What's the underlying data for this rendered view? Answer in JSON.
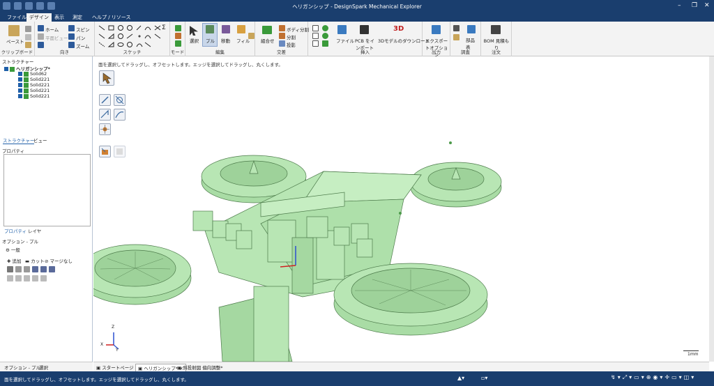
{
  "app": {
    "title": "ヘリガンシップ - DesignSpark Mechanical Explorer"
  },
  "menu_tabs": [
    "ファイル",
    "デザイン",
    "表示",
    "測定",
    "ヘルプ / リソース"
  ],
  "ribbon": {
    "clipboard": {
      "paste": "ペースト",
      "label": "クリップボード"
    },
    "orient": {
      "home": "ホーム",
      "plane": "平面ビュー",
      "spin": "スピン",
      "pan": "パン",
      "zoom": "ズーム",
      "label": "向き"
    },
    "sketch": {
      "label": "スケッチ"
    },
    "mode": {
      "label": "モード"
    },
    "edit": {
      "select": "選択",
      "pull": "プル",
      "move": "移動",
      "fill": "フィル",
      "label": "編集"
    },
    "intersect": {
      "combine": "組合せ",
      "split_body": "ボディ分割",
      "split": "分割",
      "project": "投影",
      "label": "交差"
    },
    "insert": {
      "file": "ファイル",
      "pcb": "PCB をインポート",
      "dl": "3Dモデルのダウンロード",
      "label": "挿入"
    },
    "output": {
      "export": "エクスポートオプション",
      "label": "出力"
    },
    "survey": {
      "parts": "部品表",
      "label": "調査"
    },
    "order": {
      "bom": "BOM 見積もり",
      "label": "注文"
    }
  },
  "structure": {
    "header": "ストラクチャー",
    "root": "ヘリガンシップ*",
    "items": [
      "Solid62",
      "Solid221",
      "Solid221",
      "Solid221",
      "Solid221"
    ],
    "tabs": [
      "ストラクチャー",
      "ビュー"
    ]
  },
  "properties": {
    "header": "プロパティ",
    "tabs": [
      "プロパティ",
      "レイヤ"
    ]
  },
  "options": {
    "header": "オプション - プル",
    "general": "一般",
    "add": "追加",
    "cut": "カット",
    "nomerge": "マージなし"
  },
  "viewport": {
    "hint": "面を選択してドラッグし、オフセットします。エッジを選択してドラッグし、丸くします。",
    "scale": "1mm",
    "axis_x": "X",
    "axis_y": "Y",
    "axis_z": "Z"
  },
  "bottom_tabs": [
    "スタートページ",
    "ヘリガンシップ*",
    "斜投射図 偏向調整*"
  ],
  "left_bottom_tabs": [
    "オプション - プル",
    "選択"
  ],
  "status": "面を選択してドラッグし、オフセットします。エッジを選択してドラッグし、丸くします。",
  "colors": {
    "model": "#b8e6b4",
    "edge": "#4c7a4a",
    "title": "#1a3e6e"
  }
}
